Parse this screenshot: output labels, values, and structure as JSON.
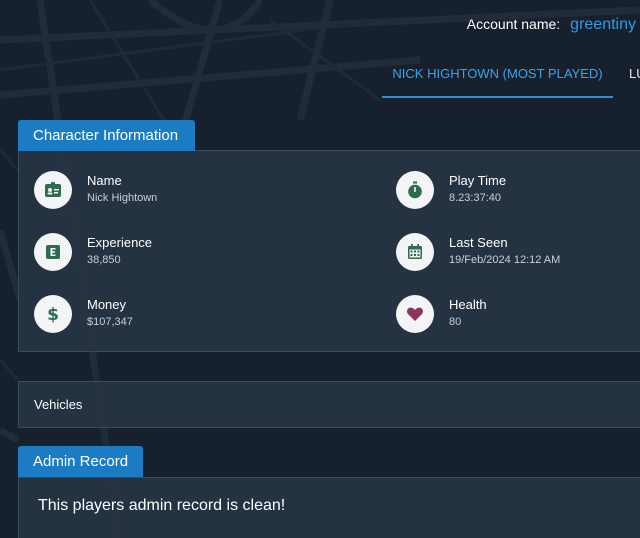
{
  "account": {
    "label": "Account name:",
    "name": "greentiny"
  },
  "tabs": [
    {
      "label": "NICK HIGHTOWN (MOST PLAYED)",
      "active": true
    },
    {
      "label": "LU",
      "active": false
    }
  ],
  "character_info": {
    "title": "Character Information",
    "stats": [
      {
        "label": "Name",
        "value": "Nick Hightown",
        "icon": "id-card-icon"
      },
      {
        "label": "Play Time",
        "value": "8.23:37:40",
        "icon": "stopwatch-icon"
      },
      {
        "label": "Experience",
        "value": "38,850",
        "icon": "experience-icon"
      },
      {
        "label": "Last Seen",
        "value": "19/Feb/2024 12:12 AM",
        "icon": "calendar-icon"
      },
      {
        "label": "Money",
        "value": "$107,347",
        "icon": "dollar-icon"
      },
      {
        "label": "Health",
        "value": "80",
        "icon": "heart-icon"
      }
    ]
  },
  "vehicles": {
    "label": "Vehicles"
  },
  "admin_record": {
    "title": "Admin Record",
    "message": "This players admin record is clean!"
  },
  "colors": {
    "accent": "#1b7cc4",
    "link": "#2f9ae8",
    "icon_green": "#2e6b4f",
    "icon_heart": "#8a3563",
    "background": "#18222f"
  }
}
